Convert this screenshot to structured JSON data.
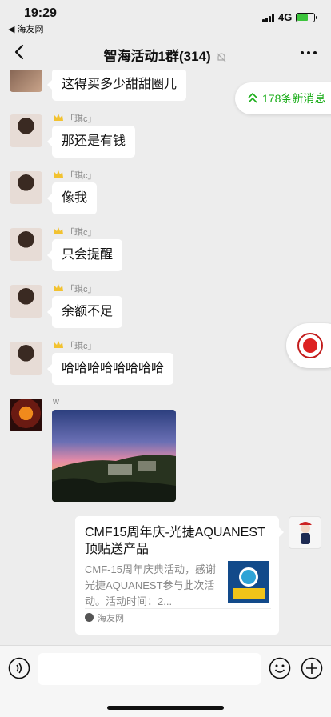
{
  "status_bar": {
    "time": "19:29",
    "back_app": "◀ 海友网",
    "network": "4G"
  },
  "nav": {
    "title": "智海活动1群(314)"
  },
  "new_messages": {
    "label": "178条新消息"
  },
  "messages": [
    {
      "sender": "",
      "text": "这得买多少甜甜圈儿"
    },
    {
      "sender": "「琪c」",
      "text": "那还是有钱"
    },
    {
      "sender": "「琪c」",
      "text": "像我"
    },
    {
      "sender": "「琪c」",
      "text": "只会提醒"
    },
    {
      "sender": "「琪c」",
      "text": "余额不足"
    },
    {
      "sender": "「琪c」",
      "text": "哈哈哈哈哈哈哈哈"
    }
  ],
  "photo_message": {
    "sender": "w"
  },
  "link_card": {
    "title": "CMF15周年庆-光捷AQUANEST顶贴送产品",
    "description": "CMF-15周年庆典活动，感谢光捷AQUANEST参与此次活动。活动时间：2...",
    "source": "海友网"
  },
  "colors": {
    "accent": "#1aad19",
    "background": "#ededed",
    "bubble": "#ffffff"
  },
  "icons": [
    "back-chevron-icon",
    "mute-bell-icon",
    "more-dots-icon",
    "double-chevron-up-icon",
    "voice-icon",
    "emoji-icon",
    "plus-icon"
  ]
}
